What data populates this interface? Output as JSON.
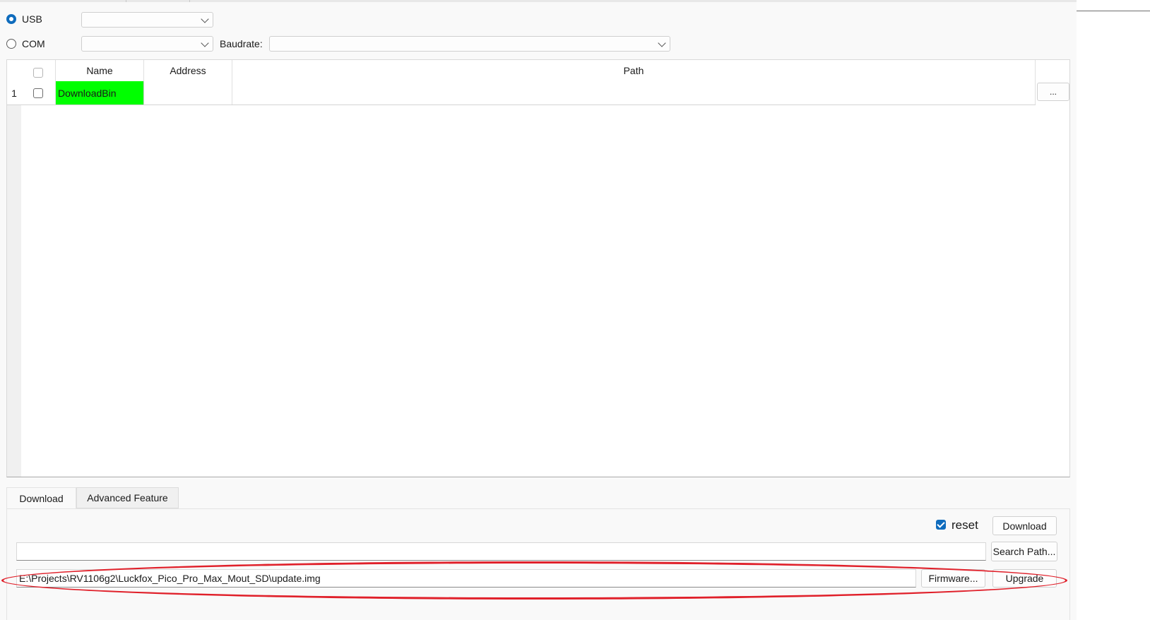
{
  "connection": {
    "usb_label": "USB",
    "com_label": "COM",
    "baudrate_label": "Baudrate:",
    "usb_selected": true
  },
  "table": {
    "columns": [
      "Name",
      "Address",
      "Path"
    ],
    "rows": [
      {
        "index": "1",
        "name": "DownloadBin",
        "address": "",
        "path": "",
        "browse_label": "..."
      }
    ],
    "name_highlight_color": "#00ff00"
  },
  "tabs": [
    {
      "label": "Download",
      "active": true
    },
    {
      "label": "Advanced Feature",
      "active": false
    }
  ],
  "download_panel": {
    "reset_label": "reset",
    "reset_checked": true,
    "download_button": "Download",
    "search_path_value": "",
    "search_path_button": "Search Path...",
    "firmware_path_value": "E:\\Projects\\RV1106g2\\Luckfox_Pico_Pro_Max_Mout_SD\\update.img",
    "firmware_button": "Firmware...",
    "upgrade_button": "Upgrade"
  },
  "colors": {
    "accent": "#0f6cbd",
    "annotation": "#e0202a"
  }
}
